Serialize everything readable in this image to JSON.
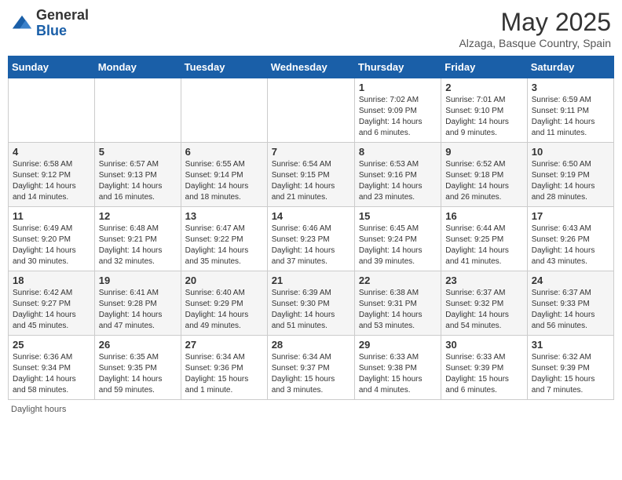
{
  "header": {
    "logo_general": "General",
    "logo_blue": "Blue",
    "month_title": "May 2025",
    "location": "Alzaga, Basque Country, Spain"
  },
  "days_of_week": [
    "Sunday",
    "Monday",
    "Tuesday",
    "Wednesday",
    "Thursday",
    "Friday",
    "Saturday"
  ],
  "weeks": [
    [
      {
        "day": "",
        "info": ""
      },
      {
        "day": "",
        "info": ""
      },
      {
        "day": "",
        "info": ""
      },
      {
        "day": "",
        "info": ""
      },
      {
        "day": "1",
        "info": "Sunrise: 7:02 AM\nSunset: 9:09 PM\nDaylight: 14 hours\nand 6 minutes."
      },
      {
        "day": "2",
        "info": "Sunrise: 7:01 AM\nSunset: 9:10 PM\nDaylight: 14 hours\nand 9 minutes."
      },
      {
        "day": "3",
        "info": "Sunrise: 6:59 AM\nSunset: 9:11 PM\nDaylight: 14 hours\nand 11 minutes."
      }
    ],
    [
      {
        "day": "4",
        "info": "Sunrise: 6:58 AM\nSunset: 9:12 PM\nDaylight: 14 hours\nand 14 minutes."
      },
      {
        "day": "5",
        "info": "Sunrise: 6:57 AM\nSunset: 9:13 PM\nDaylight: 14 hours\nand 16 minutes."
      },
      {
        "day": "6",
        "info": "Sunrise: 6:55 AM\nSunset: 9:14 PM\nDaylight: 14 hours\nand 18 minutes."
      },
      {
        "day": "7",
        "info": "Sunrise: 6:54 AM\nSunset: 9:15 PM\nDaylight: 14 hours\nand 21 minutes."
      },
      {
        "day": "8",
        "info": "Sunrise: 6:53 AM\nSunset: 9:16 PM\nDaylight: 14 hours\nand 23 minutes."
      },
      {
        "day": "9",
        "info": "Sunrise: 6:52 AM\nSunset: 9:18 PM\nDaylight: 14 hours\nand 26 minutes."
      },
      {
        "day": "10",
        "info": "Sunrise: 6:50 AM\nSunset: 9:19 PM\nDaylight: 14 hours\nand 28 minutes."
      }
    ],
    [
      {
        "day": "11",
        "info": "Sunrise: 6:49 AM\nSunset: 9:20 PM\nDaylight: 14 hours\nand 30 minutes."
      },
      {
        "day": "12",
        "info": "Sunrise: 6:48 AM\nSunset: 9:21 PM\nDaylight: 14 hours\nand 32 minutes."
      },
      {
        "day": "13",
        "info": "Sunrise: 6:47 AM\nSunset: 9:22 PM\nDaylight: 14 hours\nand 35 minutes."
      },
      {
        "day": "14",
        "info": "Sunrise: 6:46 AM\nSunset: 9:23 PM\nDaylight: 14 hours\nand 37 minutes."
      },
      {
        "day": "15",
        "info": "Sunrise: 6:45 AM\nSunset: 9:24 PM\nDaylight: 14 hours\nand 39 minutes."
      },
      {
        "day": "16",
        "info": "Sunrise: 6:44 AM\nSunset: 9:25 PM\nDaylight: 14 hours\nand 41 minutes."
      },
      {
        "day": "17",
        "info": "Sunrise: 6:43 AM\nSunset: 9:26 PM\nDaylight: 14 hours\nand 43 minutes."
      }
    ],
    [
      {
        "day": "18",
        "info": "Sunrise: 6:42 AM\nSunset: 9:27 PM\nDaylight: 14 hours\nand 45 minutes."
      },
      {
        "day": "19",
        "info": "Sunrise: 6:41 AM\nSunset: 9:28 PM\nDaylight: 14 hours\nand 47 minutes."
      },
      {
        "day": "20",
        "info": "Sunrise: 6:40 AM\nSunset: 9:29 PM\nDaylight: 14 hours\nand 49 minutes."
      },
      {
        "day": "21",
        "info": "Sunrise: 6:39 AM\nSunset: 9:30 PM\nDaylight: 14 hours\nand 51 minutes."
      },
      {
        "day": "22",
        "info": "Sunrise: 6:38 AM\nSunset: 9:31 PM\nDaylight: 14 hours\nand 53 minutes."
      },
      {
        "day": "23",
        "info": "Sunrise: 6:37 AM\nSunset: 9:32 PM\nDaylight: 14 hours\nand 54 minutes."
      },
      {
        "day": "24",
        "info": "Sunrise: 6:37 AM\nSunset: 9:33 PM\nDaylight: 14 hours\nand 56 minutes."
      }
    ],
    [
      {
        "day": "25",
        "info": "Sunrise: 6:36 AM\nSunset: 9:34 PM\nDaylight: 14 hours\nand 58 minutes."
      },
      {
        "day": "26",
        "info": "Sunrise: 6:35 AM\nSunset: 9:35 PM\nDaylight: 14 hours\nand 59 minutes."
      },
      {
        "day": "27",
        "info": "Sunrise: 6:34 AM\nSunset: 9:36 PM\nDaylight: 15 hours\nand 1 minute."
      },
      {
        "day": "28",
        "info": "Sunrise: 6:34 AM\nSunset: 9:37 PM\nDaylight: 15 hours\nand 3 minutes."
      },
      {
        "day": "29",
        "info": "Sunrise: 6:33 AM\nSunset: 9:38 PM\nDaylight: 15 hours\nand 4 minutes."
      },
      {
        "day": "30",
        "info": "Sunrise: 6:33 AM\nSunset: 9:39 PM\nDaylight: 15 hours\nand 6 minutes."
      },
      {
        "day": "31",
        "info": "Sunrise: 6:32 AM\nSunset: 9:39 PM\nDaylight: 15 hours\nand 7 minutes."
      }
    ]
  ],
  "footer": "Daylight hours"
}
